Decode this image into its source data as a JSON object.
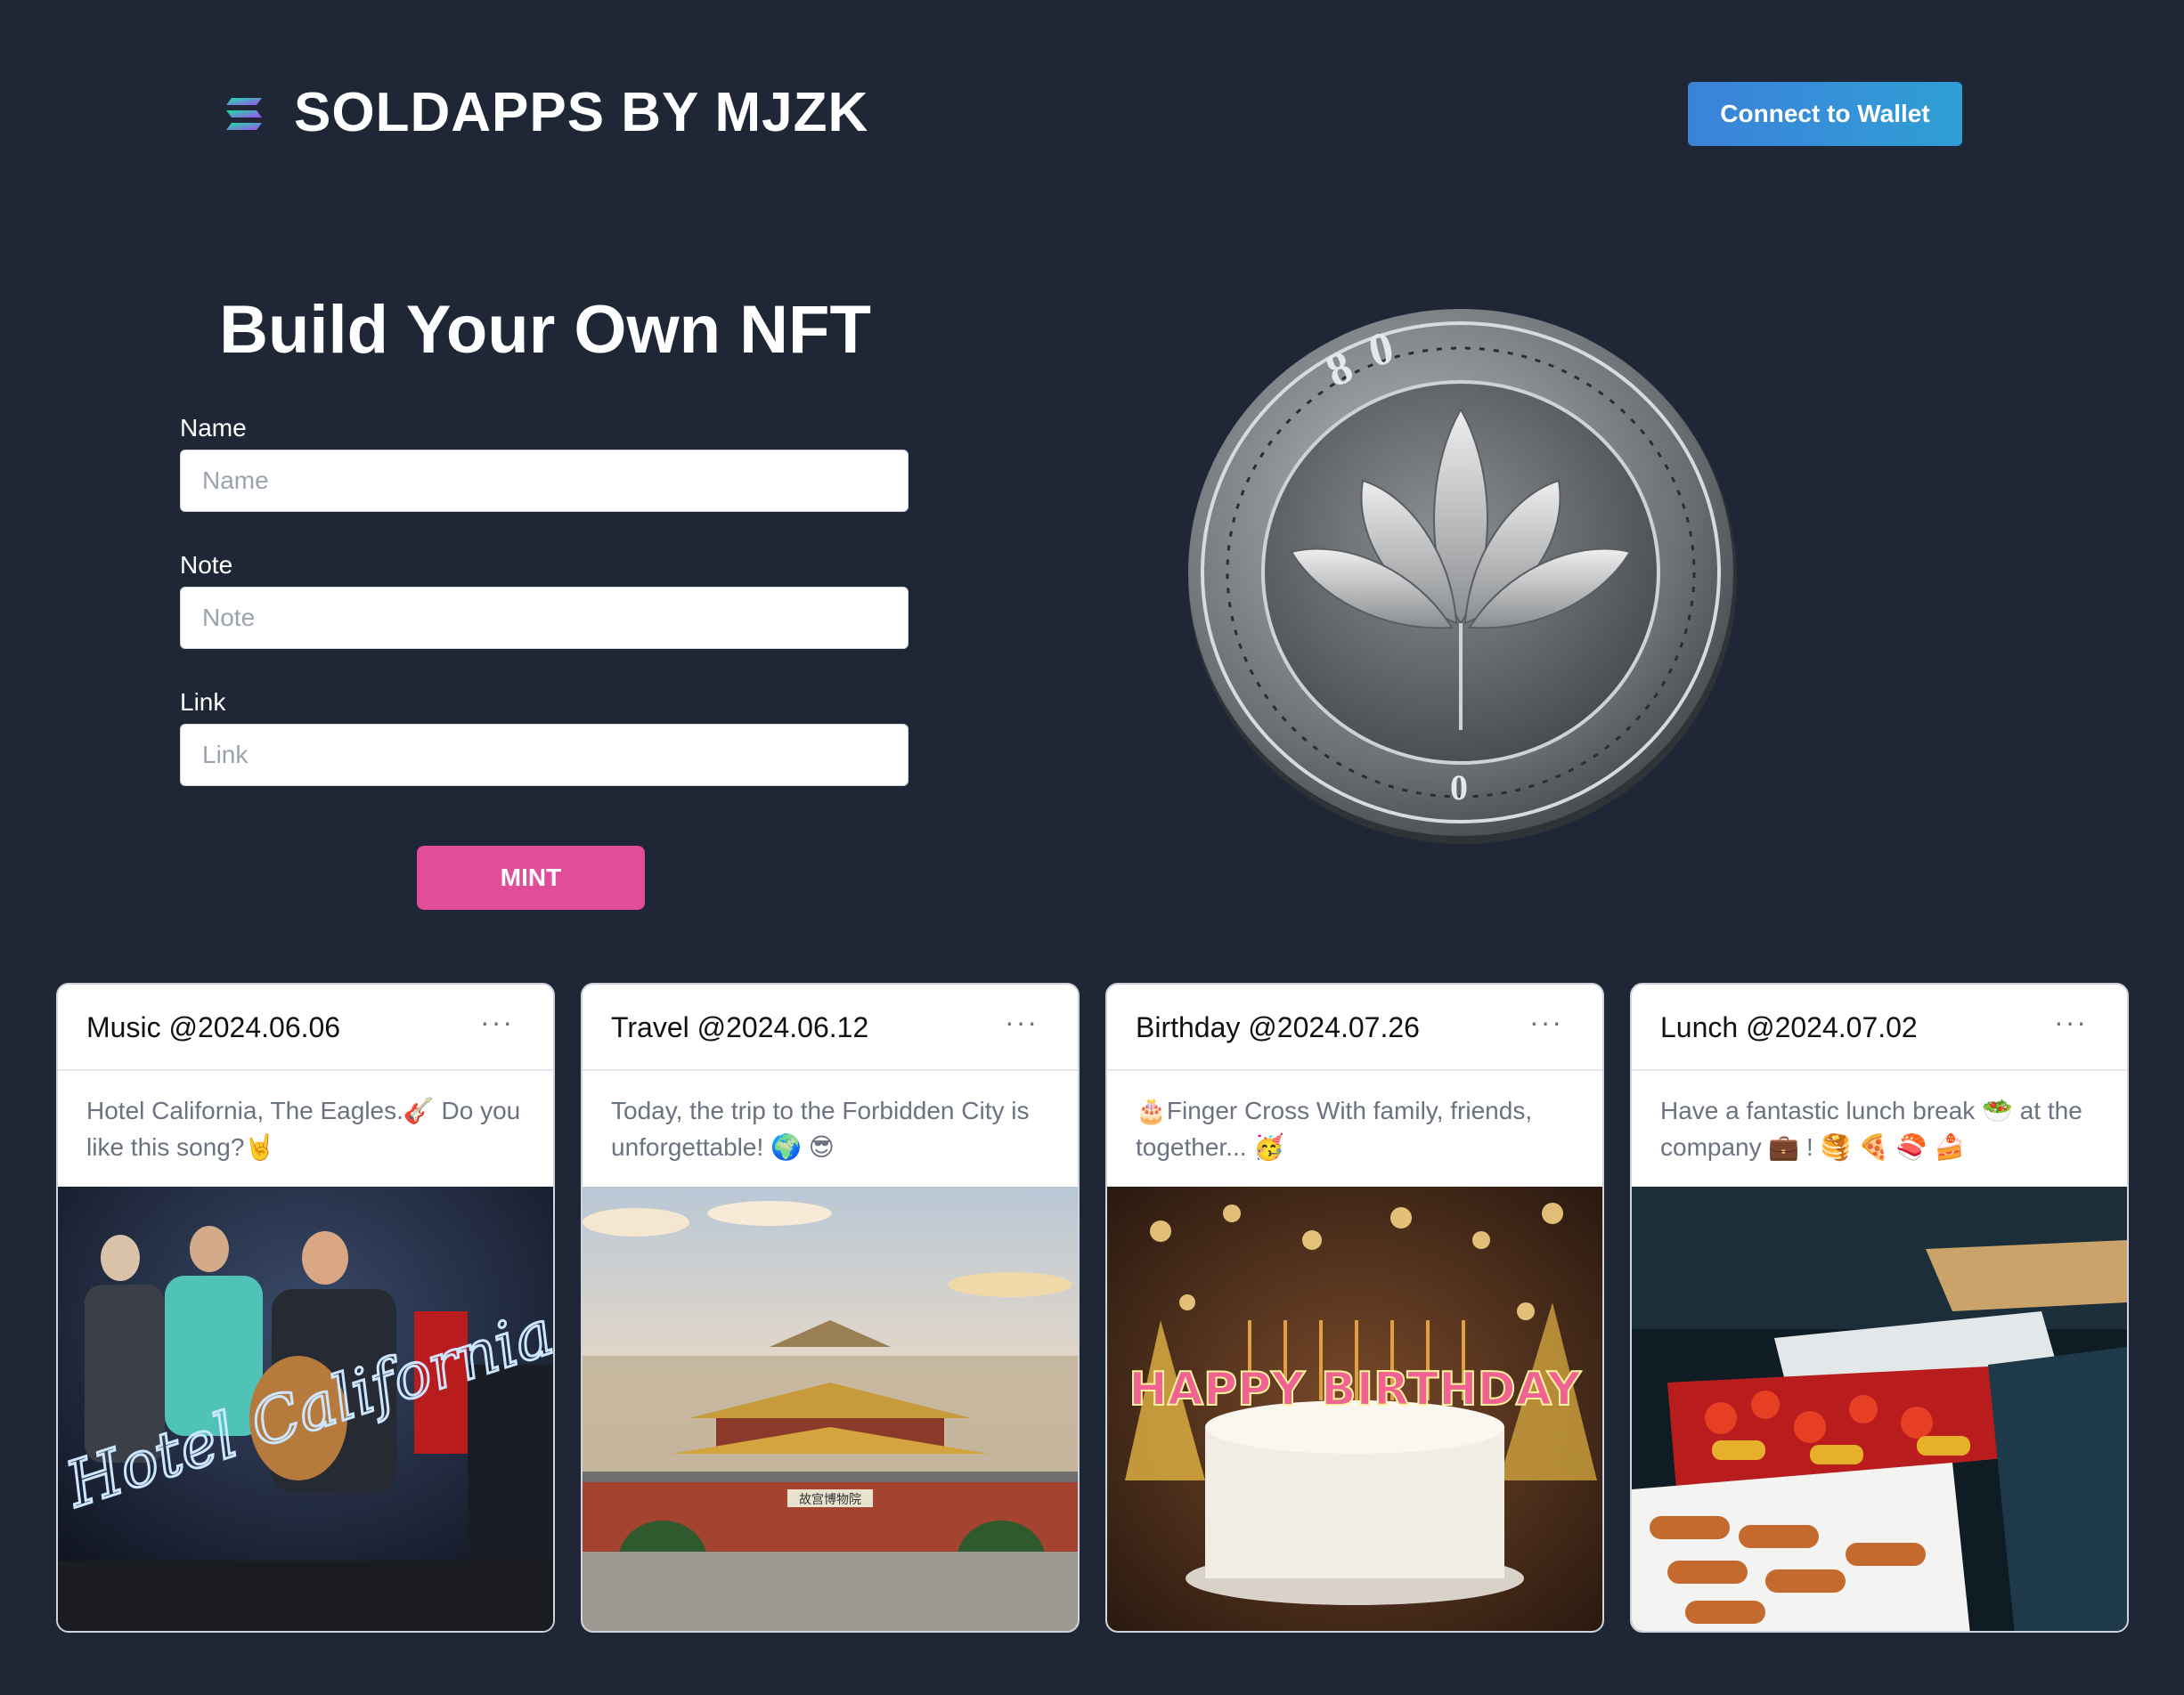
{
  "header": {
    "brand": "SOLDAPPS BY MJZK",
    "logo_icon": "solana-logo-icon",
    "connect_wallet_label": "Connect to Wallet"
  },
  "form": {
    "title": "Build Your Own NFT",
    "fields": [
      {
        "label": "Name",
        "placeholder": "Name",
        "value": ""
      },
      {
        "label": "Note",
        "placeholder": "Note",
        "value": ""
      },
      {
        "label": "Link",
        "placeholder": "Link",
        "value": ""
      }
    ],
    "mint_label": "MINT"
  },
  "hero": {
    "image": "silver-lotus-coin",
    "coin_marks": [
      "8",
      "0",
      "0"
    ]
  },
  "cards": [
    {
      "title": "Music @2024.06.06",
      "menu": "···",
      "text": "Hotel California, The Eagles.🎸 Do you like this song?🤘",
      "image": "band-concert-photo",
      "image_text": "Hotel California"
    },
    {
      "title": "Travel @2024.06.12",
      "menu": "···",
      "text": "Today, the trip to the Forbidden City is unforgettable! 🌍 😎",
      "image": "forbidden-city-photo",
      "image_text": "故宫博物院"
    },
    {
      "title": "Birthday @2024.07.26",
      "menu": "···",
      "text": "🎂Finger Cross With family, friends, together... 🥳",
      "image": "birthday-cake-photo",
      "image_text": "HAPPY BIRTHDAY"
    },
    {
      "title": "Lunch @2024.07.02",
      "menu": "···",
      "text": "Have a fantastic lunch break 🥗 at the company 💼 ! 🥞 🍕 🍣 🍰",
      "image": "buffet-food-photo",
      "image_text": ""
    }
  ],
  "colors": {
    "background": "#1f2736",
    "wallet_button": "#3b82d9",
    "mint_button": "#e24d9a"
  }
}
